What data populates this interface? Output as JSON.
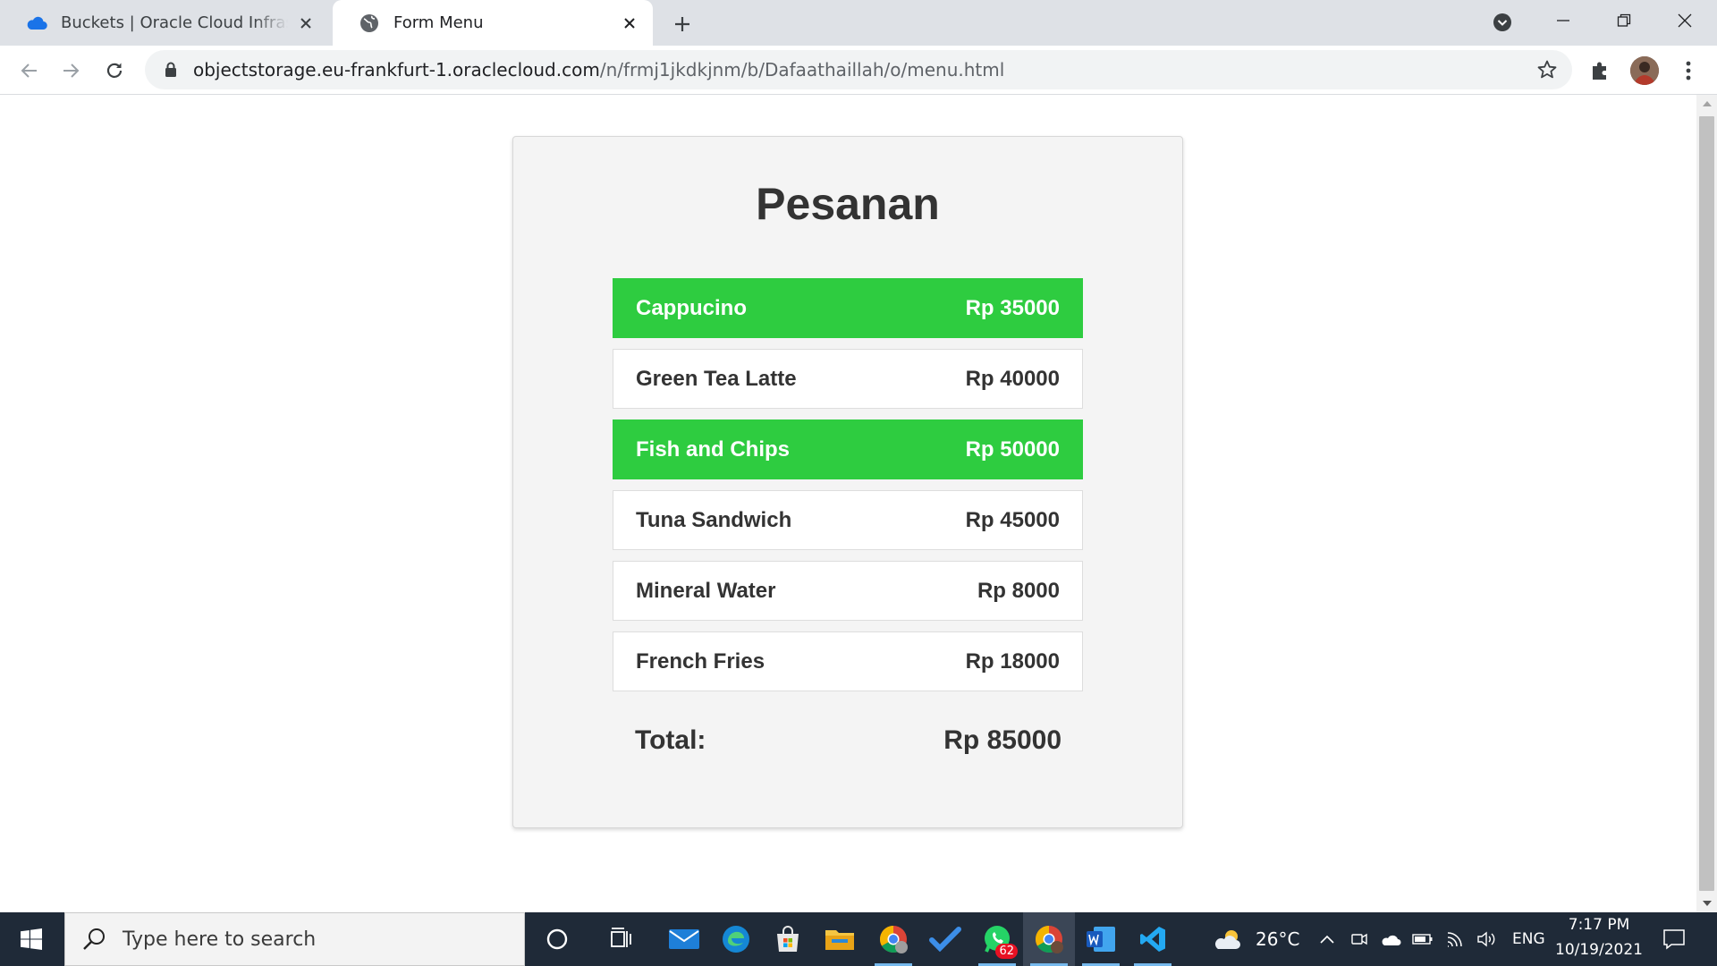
{
  "browser": {
    "tabs": [
      {
        "title": "Buckets | Oracle Cloud Infrastructure",
        "icon": "oracle-cloud-icon",
        "active": false
      },
      {
        "title": "Form Menu",
        "icon": "globe-icon",
        "active": true
      }
    ],
    "url_host": "objectstorage.eu-frankfurt-1.oraclecloud.com",
    "url_path": "/n/frmj1jkdkjnm/b/Dafaathaillah/o/menu.html"
  },
  "page": {
    "title": "Pesanan",
    "items": [
      {
        "name": "Cappucino",
        "price": "Rp 35000",
        "selected": true
      },
      {
        "name": "Green Tea Latte",
        "price": "Rp 40000",
        "selected": false
      },
      {
        "name": "Fish and Chips",
        "price": "Rp 50000",
        "selected": true
      },
      {
        "name": "Tuna Sandwich",
        "price": "Rp 45000",
        "selected": false
      },
      {
        "name": "Mineral Water",
        "price": "Rp 8000",
        "selected": false
      },
      {
        "name": "French Fries",
        "price": "Rp 18000",
        "selected": false
      }
    ],
    "total_label": "Total:",
    "total_value": "Rp 85000",
    "colors": {
      "selected": "#2ecc40",
      "card": "#f4f4f4",
      "text": "#333333"
    }
  },
  "taskbar": {
    "search_placeholder": "Type here to search",
    "whatsapp_badge": "62",
    "weather": "26°C",
    "language": "ENG",
    "time": "7:17 PM",
    "date": "10/19/2021"
  }
}
